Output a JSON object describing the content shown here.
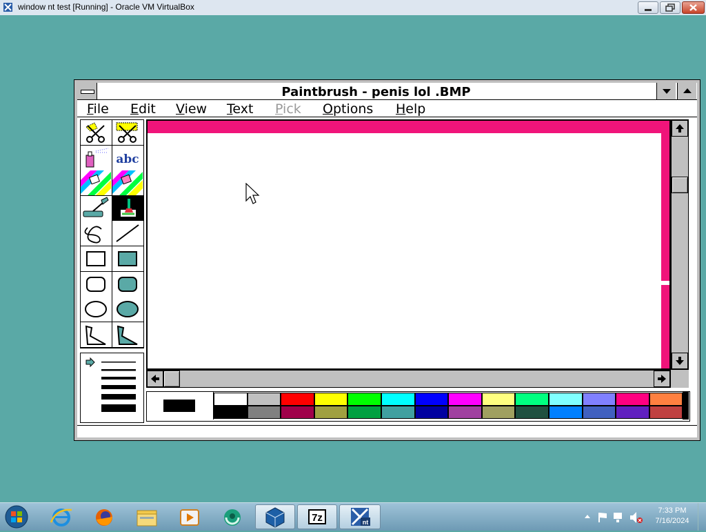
{
  "host": {
    "title": "window nt test [Running] - Oracle VM VirtualBox"
  },
  "paint": {
    "title": "Paintbrush - penis lol .BMP",
    "menu": [
      {
        "label": "File",
        "accel": "F",
        "rest": "ile",
        "enabled": true
      },
      {
        "label": "Edit",
        "accel": "E",
        "rest": "dit",
        "enabled": true
      },
      {
        "label": "View",
        "accel": "V",
        "rest": "iew",
        "enabled": true
      },
      {
        "label": "Text",
        "accel": "T",
        "rest": "ext",
        "enabled": true
      },
      {
        "label": "Pick",
        "accel": "P",
        "rest": "ick",
        "enabled": false
      },
      {
        "label": "Options",
        "accel": "O",
        "rest": "ptions",
        "enabled": true
      },
      {
        "label": "Help",
        "accel": "H",
        "rest": "elp",
        "enabled": true
      }
    ],
    "tools": [
      "scissors-icon",
      "pick-scissors-icon",
      "airbrush-icon",
      "text-tool-icon",
      "color-eraser-icon",
      "eraser-icon",
      "paint-roller-icon",
      "brush-icon",
      "curve-icon",
      "line-icon",
      "box-icon",
      "filled-box-icon",
      "rounded-box-icon",
      "filled-rounded-box-icon",
      "circle-icon",
      "filled-circle-icon",
      "polygon-icon",
      "filled-polygon-icon"
    ],
    "text_tool_label": "abc",
    "selected_tool": "brush-icon",
    "canvas_stroke_color": "#f0147a",
    "foreground_color": "#000000",
    "background_color": "#ffffff",
    "palette_top": [
      "#ffffff",
      "#c0c0c0",
      "#ff0000",
      "#ffff00",
      "#00ff00",
      "#00ffff",
      "#0000ff",
      "#ff00ff",
      "#ffff80",
      "#00ff80",
      "#80ffff",
      "#8080ff",
      "#ff0080",
      "#ff8040"
    ],
    "palette_bottom": [
      "#000000",
      "#808080",
      "#a0004a",
      "#a0a040",
      "#00a040",
      "#40a0a0",
      "#0000a0",
      "#a040a0",
      "#a0a060",
      "#205040",
      "#0080ff",
      "#4060c0",
      "#6020c0",
      "#c04040"
    ]
  },
  "taskbar": {
    "apps": [
      "start-orb-icon",
      "internet-explorer-icon",
      "firefox-icon",
      "file-explorer-icon",
      "media-player-icon",
      "browser-icon",
      "virtualbox-icon",
      "7zip-icon",
      "windows-nt-vm-icon"
    ],
    "seven_zip_label": "7z",
    "nt_label": "nt",
    "clock_time": "7:33 PM",
    "clock_date": "7/16/2024"
  }
}
